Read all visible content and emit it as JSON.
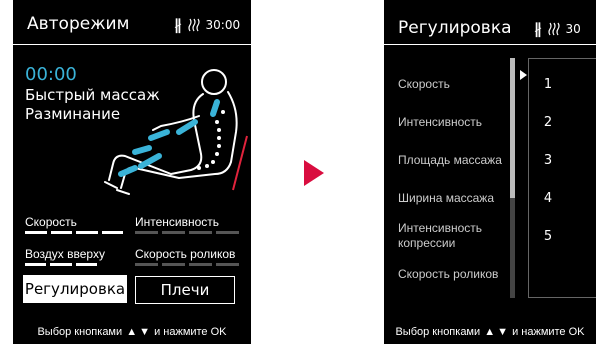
{
  "colors": {
    "accent": "#3ab3d8",
    "arrow": "#d90d3f",
    "highlight_line": "#e1233c",
    "background": "#000000"
  },
  "left_screen": {
    "title": "Авторежим",
    "status": {
      "bluetooth_icon": "bluetooth-icon",
      "heat_icon": "heat-icon",
      "time": "30:00"
    },
    "timer": "00:00",
    "program_line1": "Быстрый массаж",
    "program_line2": "Разминание",
    "levels": [
      {
        "label": "Скорость",
        "level": 4,
        "max": 4
      },
      {
        "label": "Интенсивность",
        "level": 0,
        "max": 4
      },
      {
        "label": "Воздух вверху",
        "level": 3,
        "max": 3
      },
      {
        "label": "Скорость роликов",
        "level": 0,
        "max": 4
      }
    ],
    "btn_adjust": "Регулировка",
    "btn_shoulders": "Плечи",
    "footer_prefix": "Выбор кнопками",
    "footer_suffix": "и нажмите OK"
  },
  "right_screen": {
    "title": "Регулировка",
    "status": {
      "bluetooth_icon": "bluetooth-icon",
      "heat_icon": "heat-icon",
      "time": "30"
    },
    "items": [
      "Скорость",
      "Интенсивность",
      "Площадь массажа",
      "Ширина массажа",
      "Интенсивность копрессии",
      "Скорость роликов"
    ],
    "values": [
      "1",
      "2",
      "3",
      "4",
      "5"
    ],
    "footer_prefix": "Выбор кнопками",
    "footer_suffix": "и нажмите OK"
  }
}
